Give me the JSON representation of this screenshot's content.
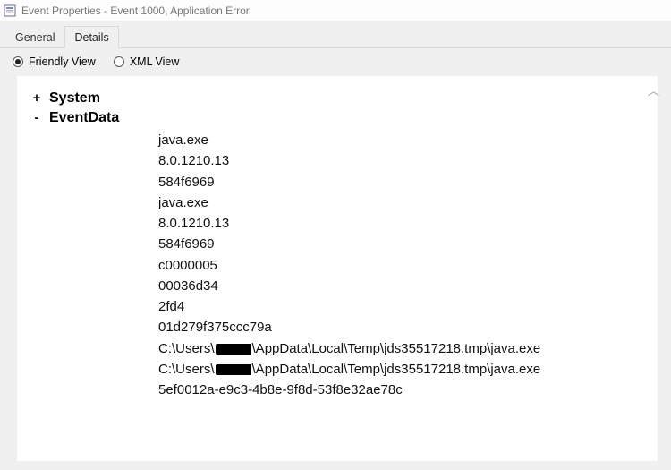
{
  "window": {
    "title": "Event Properties - Event 1000, Application Error"
  },
  "tabs": {
    "general": "General",
    "details": "Details",
    "active": "details"
  },
  "viewmode": {
    "friendly": "Friendly View",
    "xml": "XML View",
    "selected": "friendly"
  },
  "tree": {
    "system": {
      "toggle": "+",
      "label": "System"
    },
    "eventdata": {
      "toggle": "-",
      "label": "EventData"
    }
  },
  "eventdata_lines": [
    "java.exe",
    "8.0.1210.13",
    "584f6969",
    "java.exe",
    "8.0.1210.13",
    "584f6969",
    "c0000005",
    "00036d34",
    "2fd4",
    "01d279f375ccc79a",
    "C:\\Users\\██\\AppData\\Local\\Temp\\jds35517218.tmp\\java.exe",
    "C:\\Users\\██\\AppData\\Local\\Temp\\jds35517218.tmp\\java.exe",
    "5ef0012a-e9c3-4b8e-9f8d-53f8e32ae78c"
  ]
}
